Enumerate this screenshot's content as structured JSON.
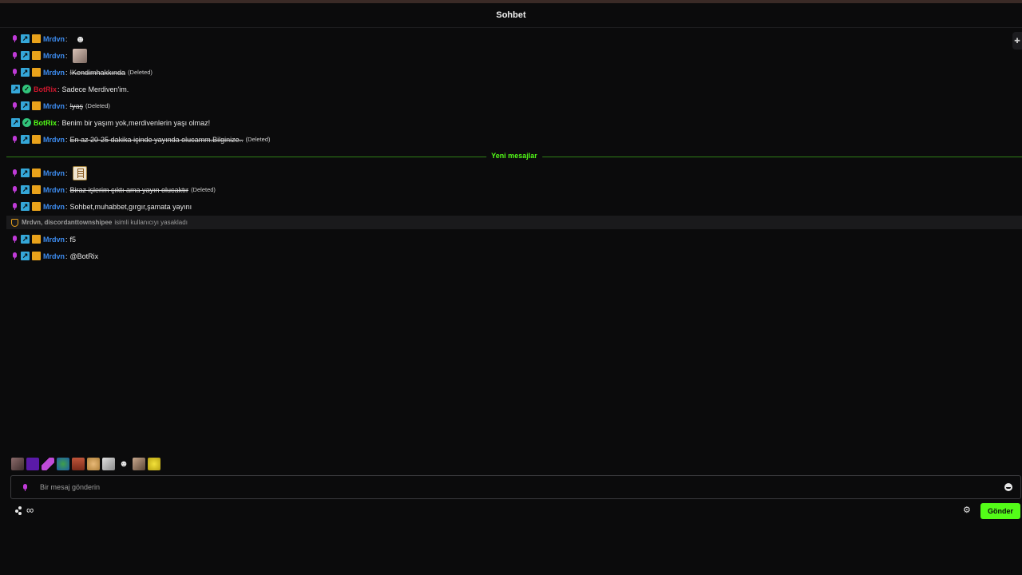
{
  "header": {
    "title": "Sohbet"
  },
  "colors": {
    "kick_green": "#53fc18",
    "username_blue": "#3d8cf0",
    "username_red": "#d0182e",
    "sub_purple": "#c03ad8",
    "verified_blue": "#35a7d8",
    "crown_gold": "#e9a21b"
  },
  "messages_before": [
    {
      "user": "Mrdvn",
      "emote": "ghost-emote"
    },
    {
      "user": "Mrdvn",
      "emote": "cat-emote"
    },
    {
      "user": "Mrdvn",
      "text": "!Kendimhakkında",
      "deleted_label": "(Deleted)"
    },
    {
      "user": "BotRix",
      "text": "Sadece Merdiven'im."
    },
    {
      "user": "Mrdvn",
      "text": "!yaş",
      "deleted_label": "(Deleted)"
    },
    {
      "user": "BotRix",
      "text": "Benim bir yaşım yok,merdivenlerin yaşı olmaz!"
    },
    {
      "user": "Mrdvn",
      "text": "En az 20-25 dakika içinde yayında olucamm.Bilginize..",
      "deleted_label": "(Deleted)"
    }
  ],
  "divider_label": "Yeni mesajlar",
  "messages_after": [
    {
      "user": "Mrdvn",
      "emote": "ladder-emote"
    },
    {
      "user": "Mrdvn",
      "text": "Biraz işlerim çıktı ama yayın olucaktır",
      "deleted_label": "(Deleted)"
    },
    {
      "user": "Mrdvn",
      "text": "Sohbet,muhabbet,gırgır,şamata yayını"
    }
  ],
  "mod_action": {
    "names": "Mrdvn, discordanttownshipee",
    "action": "isimli kullanıcıyı yasakladı"
  },
  "messages_last": [
    {
      "user": "Mrdvn",
      "text": "f5"
    },
    {
      "user": "Mrdvn",
      "text": "@BotRix"
    }
  ],
  "input": {
    "placeholder": "Bir mesaj gönderin"
  },
  "footer": {
    "infinity_symbol": "∞",
    "send_label": "Gönder"
  },
  "icons": [
    "pin-icon",
    "microphone-icon",
    "verified-icon",
    "crown-icon",
    "bot-icon",
    "shield-icon",
    "emoji-icon",
    "gear-icon",
    "dots-icon",
    "infinity-icon"
  ]
}
